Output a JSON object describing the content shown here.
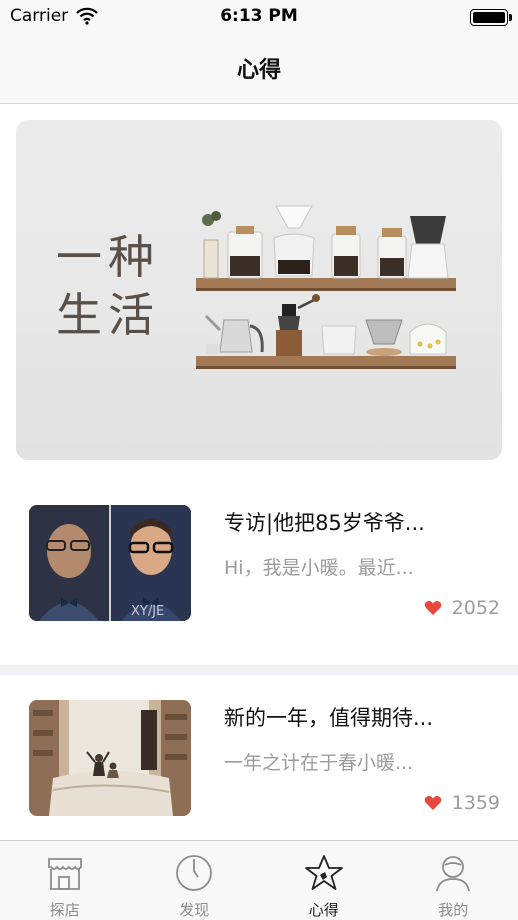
{
  "status_bar": {
    "carrier": "Carrier",
    "time": "6:13 PM"
  },
  "nav": {
    "title": "心得"
  },
  "banner": {
    "line1": "一种",
    "line2": "生活"
  },
  "articles": [
    {
      "title": "专访|他把85岁爷爷...",
      "summary": "Hi，我是小暖。最近...",
      "likes": "2052"
    },
    {
      "title": "新的一年，值得期待...",
      "summary": "一年之计在于春小暖...",
      "likes": "1359"
    }
  ],
  "thumb1_watermark": "XY/JE",
  "tabs": [
    {
      "label": "探店",
      "icon": "storefront-icon"
    },
    {
      "label": "发现",
      "icon": "compass-icon"
    },
    {
      "label": "心得",
      "icon": "star-icon",
      "active": true
    },
    {
      "label": "我的",
      "icon": "profile-icon"
    }
  ],
  "colors": {
    "heart": "#e8473d",
    "active_tab": "#222222",
    "inactive_tab": "#8c8c8c"
  }
}
